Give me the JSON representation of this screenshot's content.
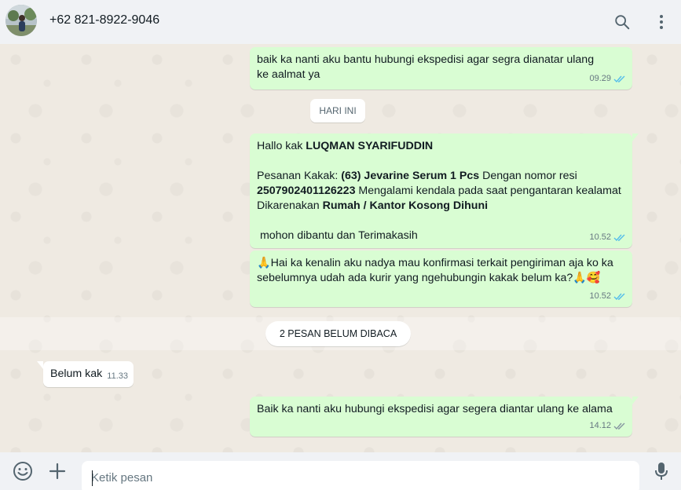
{
  "header": {
    "contact_name": "+62 821-8922-9046"
  },
  "icons": {
    "search": "search-icon",
    "menu": "kebab-menu-icon",
    "emoji": "emoji-icon",
    "attach": "plus-icon",
    "mic": "microphone-icon",
    "ticks": "double-check-icon"
  },
  "colors": {
    "outgoing_bubble": "#d9fdd3",
    "incoming_bubble": "#ffffff",
    "chat_background": "#efeae2",
    "read_ticks": "#53bdeb",
    "delivered_ticks": "#8696a0"
  },
  "messages": [
    {
      "direction": "out",
      "text": "baik ka nanti aku bantu hubungi ekspedisi agar segra dianatar ulang ke aalmat ya",
      "time": "09.29",
      "status": "read"
    },
    {
      "direction": "out",
      "greeting_prefix": "Hallo kak ",
      "greeting_name": "LUQMAN SYARIFUDDIN",
      "order_prefix": "Pesanan Kakak: ",
      "order_product": "(63) Jevarine Serum 1 Pcs",
      "order_resi_label": " Dengan nomor resi",
      "resi_number": "250790240112622 3",
      "resi_suffix": " Mengalami kendala pada saat pengantaran kealamat",
      "reason_prefix": "Dikarenakan ",
      "reason": "Rumah / Kantor Kosong Dihuni",
      "closing": " mohon dibantu dan Terimakasih",
      "time": "10.52",
      "status": "read"
    },
    {
      "direction": "out",
      "emoji_start": "🙏",
      "line1": "Hai ka kenalin aku nadya mau konfirmasi terkait pengiriman aja ko ka",
      "line2": "sebelumnya udah ada kurir yang ngehubungin kakak belum ka?",
      "emoji_end": "🙏🥰",
      "time": "10.52",
      "status": "read"
    },
    {
      "direction": "in",
      "text": "Belum kak",
      "time": "11.33"
    },
    {
      "direction": "out",
      "text": "Baik ka nanti aku hubungi ekspedisi agar segera diantar ulang ke alama",
      "time": "14.12",
      "status": "delivered"
    }
  ],
  "date_divider": "HARI INI",
  "unread_divider": "2 PESAN BELUM DIBACA",
  "composer": {
    "placeholder": "Ketik pesan",
    "value": ""
  }
}
